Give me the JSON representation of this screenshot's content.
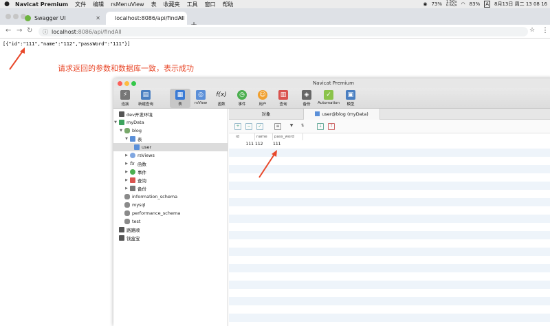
{
  "menubar": {
    "app_name": "Navicat Premium",
    "menus": [
      "文件",
      "编辑",
      "rsMenuView",
      "表",
      "收藏夹",
      "工具",
      "窗口",
      "帮助"
    ],
    "battery": "73%",
    "net_up": "1.5K/s",
    "net_down": "0.5K/s",
    "wifi_pct": "83%",
    "input_method": "A",
    "datetime": "8月13日 周二 13 08 16"
  },
  "browser": {
    "tabs": [
      {
        "title": "Swagger UI"
      },
      {
        "title": "localhost:8086/api/findAll"
      }
    ],
    "url_host": "localhost",
    "url_path": ":8086/api/findAll"
  },
  "page": {
    "json_text": "[{\"id\":\"111\",\"name\":\"112\",\"passWord\":\"111\"}]",
    "annotation": "请求返回的参数和数据库一致，表示成功"
  },
  "navicat": {
    "window_title": "Navicat Premium",
    "toolbar": [
      {
        "label": "连接",
        "icon": "plug-icon"
      },
      {
        "label": "新建查询",
        "icon": "new-query-icon"
      },
      {
        "label": "表",
        "icon": "table-icon"
      },
      {
        "label": "rsView",
        "icon": "view-icon"
      },
      {
        "label": "函数",
        "icon": "function-icon"
      },
      {
        "label": "事件",
        "icon": "clock-icon"
      },
      {
        "label": "用户",
        "icon": "user-icon"
      },
      {
        "label": "查询",
        "icon": "query-icon"
      },
      {
        "label": "备份",
        "icon": "backup-icon"
      },
      {
        "label": "Automation",
        "icon": "automation-icon"
      },
      {
        "label": "模型",
        "icon": "model-icon"
      }
    ],
    "tree": [
      {
        "label": "dev开发环境",
        "level": 0,
        "icon": "connection-icon"
      },
      {
        "label": "myData",
        "level": 0,
        "icon": "connection-icon"
      },
      {
        "label": "blog",
        "level": 1,
        "icon": "database-icon"
      },
      {
        "label": "表",
        "level": 2,
        "icon": "tables-folder-icon"
      },
      {
        "label": "user",
        "level": 3,
        "icon": "table-icon"
      },
      {
        "label": "rsViews",
        "level": 2,
        "icon": "views-folder-icon"
      },
      {
        "label": "函数",
        "level": 2,
        "icon": "functions-folder-icon"
      },
      {
        "label": "事件",
        "level": 2,
        "icon": "events-folder-icon"
      },
      {
        "label": "查询",
        "level": 2,
        "icon": "queries-folder-icon"
      },
      {
        "label": "备份",
        "level": 2,
        "icon": "backups-folder-icon"
      },
      {
        "label": "information_schema",
        "level": 1,
        "icon": "database-icon"
      },
      {
        "label": "mysql",
        "level": 1,
        "icon": "database-icon"
      },
      {
        "label": "performance_schema",
        "level": 1,
        "icon": "database-icon"
      },
      {
        "label": "test",
        "level": 1,
        "icon": "database-icon"
      },
      {
        "label": "路路顺",
        "level": 0,
        "icon": "connection-icon"
      },
      {
        "label": "钱盒宝",
        "level": 0,
        "icon": "connection-icon"
      }
    ],
    "tabs": [
      "对象",
      "user@blog (myData)"
    ],
    "columns": [
      "id",
      "name",
      "pass_word"
    ],
    "rows": [
      [
        "111",
        "112",
        "111"
      ]
    ]
  }
}
